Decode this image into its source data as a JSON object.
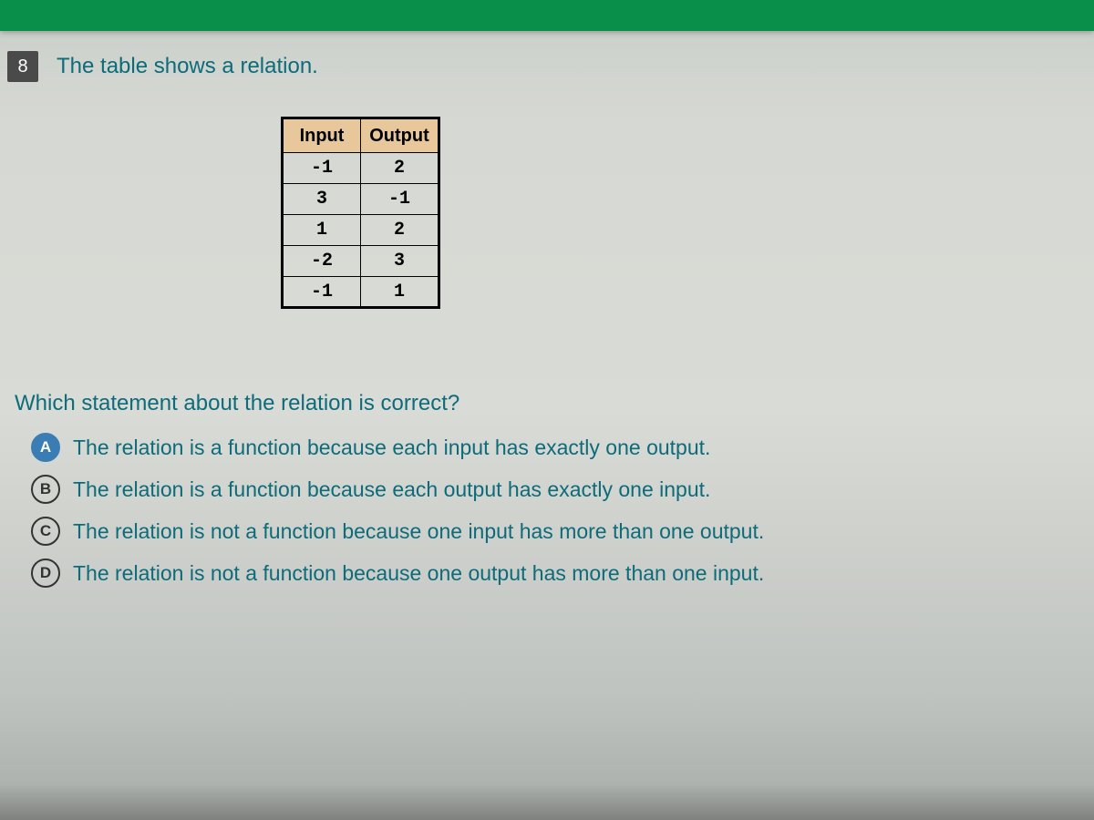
{
  "question": {
    "number": "8",
    "intro": "The table shows a relation.",
    "prompt": "Which statement about the relation is correct?"
  },
  "table": {
    "headers": [
      "Input",
      "Output"
    ],
    "rows": [
      [
        "-1",
        "2"
      ],
      [
        "3",
        "-1"
      ],
      [
        "1",
        "2"
      ],
      [
        "-2",
        "3"
      ],
      [
        "-1",
        "1"
      ]
    ]
  },
  "choices": [
    {
      "letter": "A",
      "text": "The relation is a function because each input has exactly one output.",
      "selected": true
    },
    {
      "letter": "B",
      "text": "The relation is a function because each output has exactly one input.",
      "selected": false
    },
    {
      "letter": "C",
      "text": "The relation is not a function because one input has more than one output.",
      "selected": false
    },
    {
      "letter": "D",
      "text": "The relation is not a function because one output has more than one input.",
      "selected": false
    }
  ]
}
